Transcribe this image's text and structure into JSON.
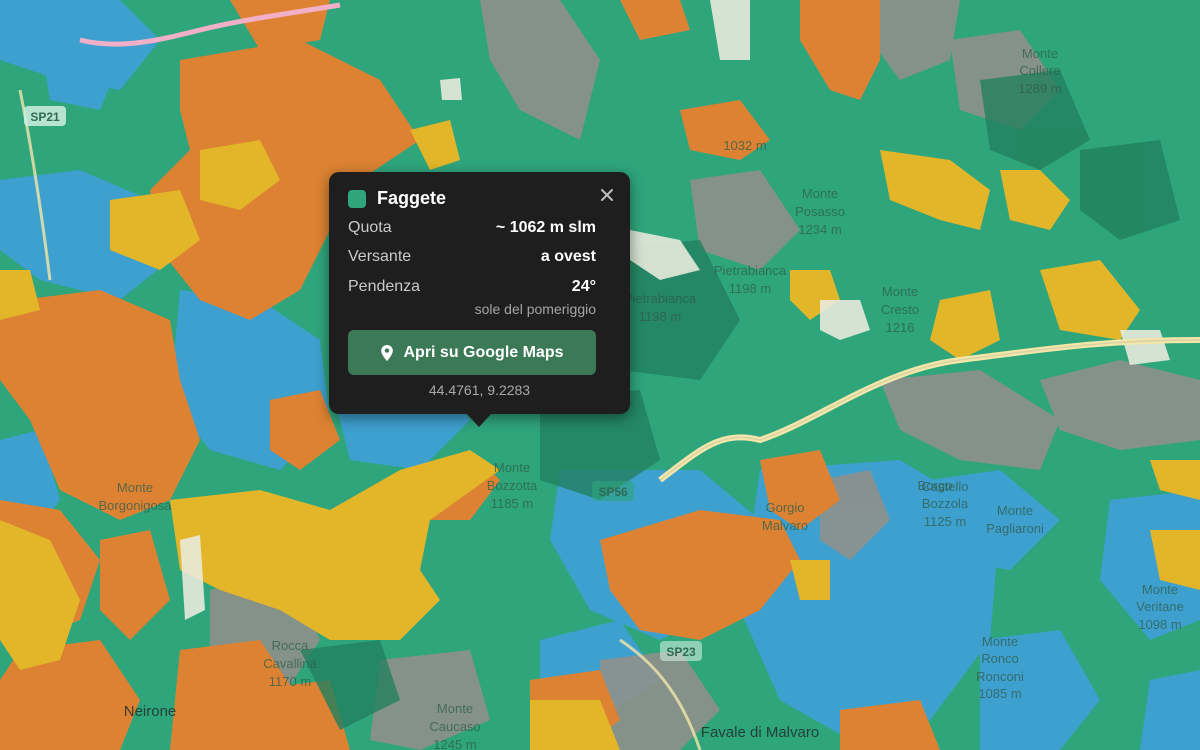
{
  "map": {
    "colors": {
      "beech": "#2fa57c",
      "orange": "#dd8233",
      "blue": "#3ea0cf",
      "yellow": "#e3b62a",
      "gray": "#8a8a88",
      "pale": "#e8eadc",
      "road": "#f3e6a9",
      "pink_road": "#f2b0c8"
    },
    "road_labels": [
      "SP21",
      "SP56",
      "SP23"
    ],
    "place_labels": [
      "Monte",
      "Collere",
      "1289 m",
      "1032 m",
      "Monte",
      "Posasso",
      "1234 m",
      "Pietrabianca",
      "1198 m",
      "Pietrabianca",
      "1198 m",
      "Monte",
      "Cresto",
      "1216",
      "Monte",
      "Bozzotta",
      "1185 m",
      "Monte",
      "Borgonigosa",
      "Rocca",
      "Cavallina",
      "1170 m",
      "Neirone",
      "Monte",
      "Caucaso",
      "1245 m",
      "Monte",
      "Ronco",
      "Ronconi",
      "1085 m",
      "Borgo",
      "Monte",
      "Pagliaroni",
      "Monte",
      "Veritane",
      "1098 m",
      "Castello",
      "Bozzola",
      "1125 m",
      "Gorgio",
      "Malvaro",
      "Favale di Malvaro"
    ]
  },
  "popup": {
    "title": "Faggete",
    "swatch_color": "#2fa57c",
    "close_icon": "close-icon",
    "rows": [
      {
        "label": "Quota",
        "value": "~ 1062 m slm"
      },
      {
        "label": "Versante",
        "value": "a ovest"
      },
      {
        "label": "Pendenza",
        "value": "24°"
      }
    ],
    "note": "sole del pomeriggio",
    "button": {
      "label": "Apri su Google Maps",
      "icon": "map-pin-icon"
    },
    "coordinates": "44.4761, 9.2283"
  }
}
